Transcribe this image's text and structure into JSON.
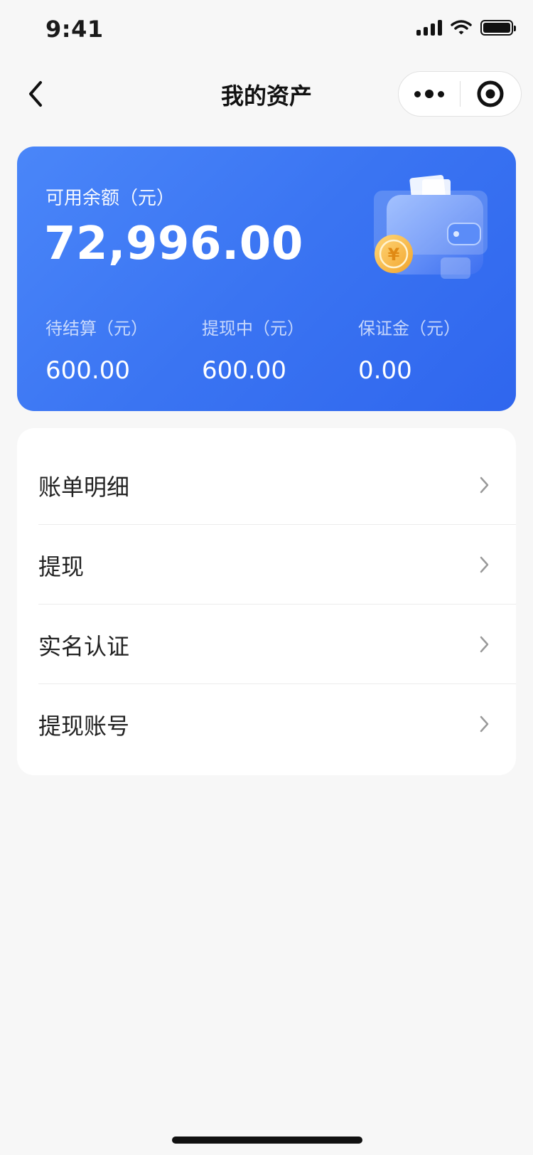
{
  "status_bar": {
    "time": "9:41"
  },
  "nav": {
    "title": "我的资产"
  },
  "asset_card": {
    "available_label": "可用余额（元）",
    "available_amount": "72,996.00",
    "stats": [
      {
        "label": "待结算（元）",
        "value": "600.00"
      },
      {
        "label": "提现中（元）",
        "value": "600.00"
      },
      {
        "label": "保证金（元）",
        "value": "0.00"
      }
    ],
    "coin_symbol": "¥"
  },
  "menu": {
    "items": [
      {
        "label": "账单明细"
      },
      {
        "label": "提现"
      },
      {
        "label": "实名认证"
      },
      {
        "label": "提现账号"
      }
    ]
  },
  "colors": {
    "card_gradient_start": "#4a86f9",
    "card_gradient_end": "#2f66ee",
    "page_background": "#f7f7f7"
  },
  "icons": [
    "back-arrow-icon",
    "more-dots-icon",
    "close-target-icon",
    "signal-icon",
    "wifi-icon",
    "battery-icon",
    "wallet-icon",
    "yuan-coin-icon",
    "chevron-right-icon"
  ]
}
